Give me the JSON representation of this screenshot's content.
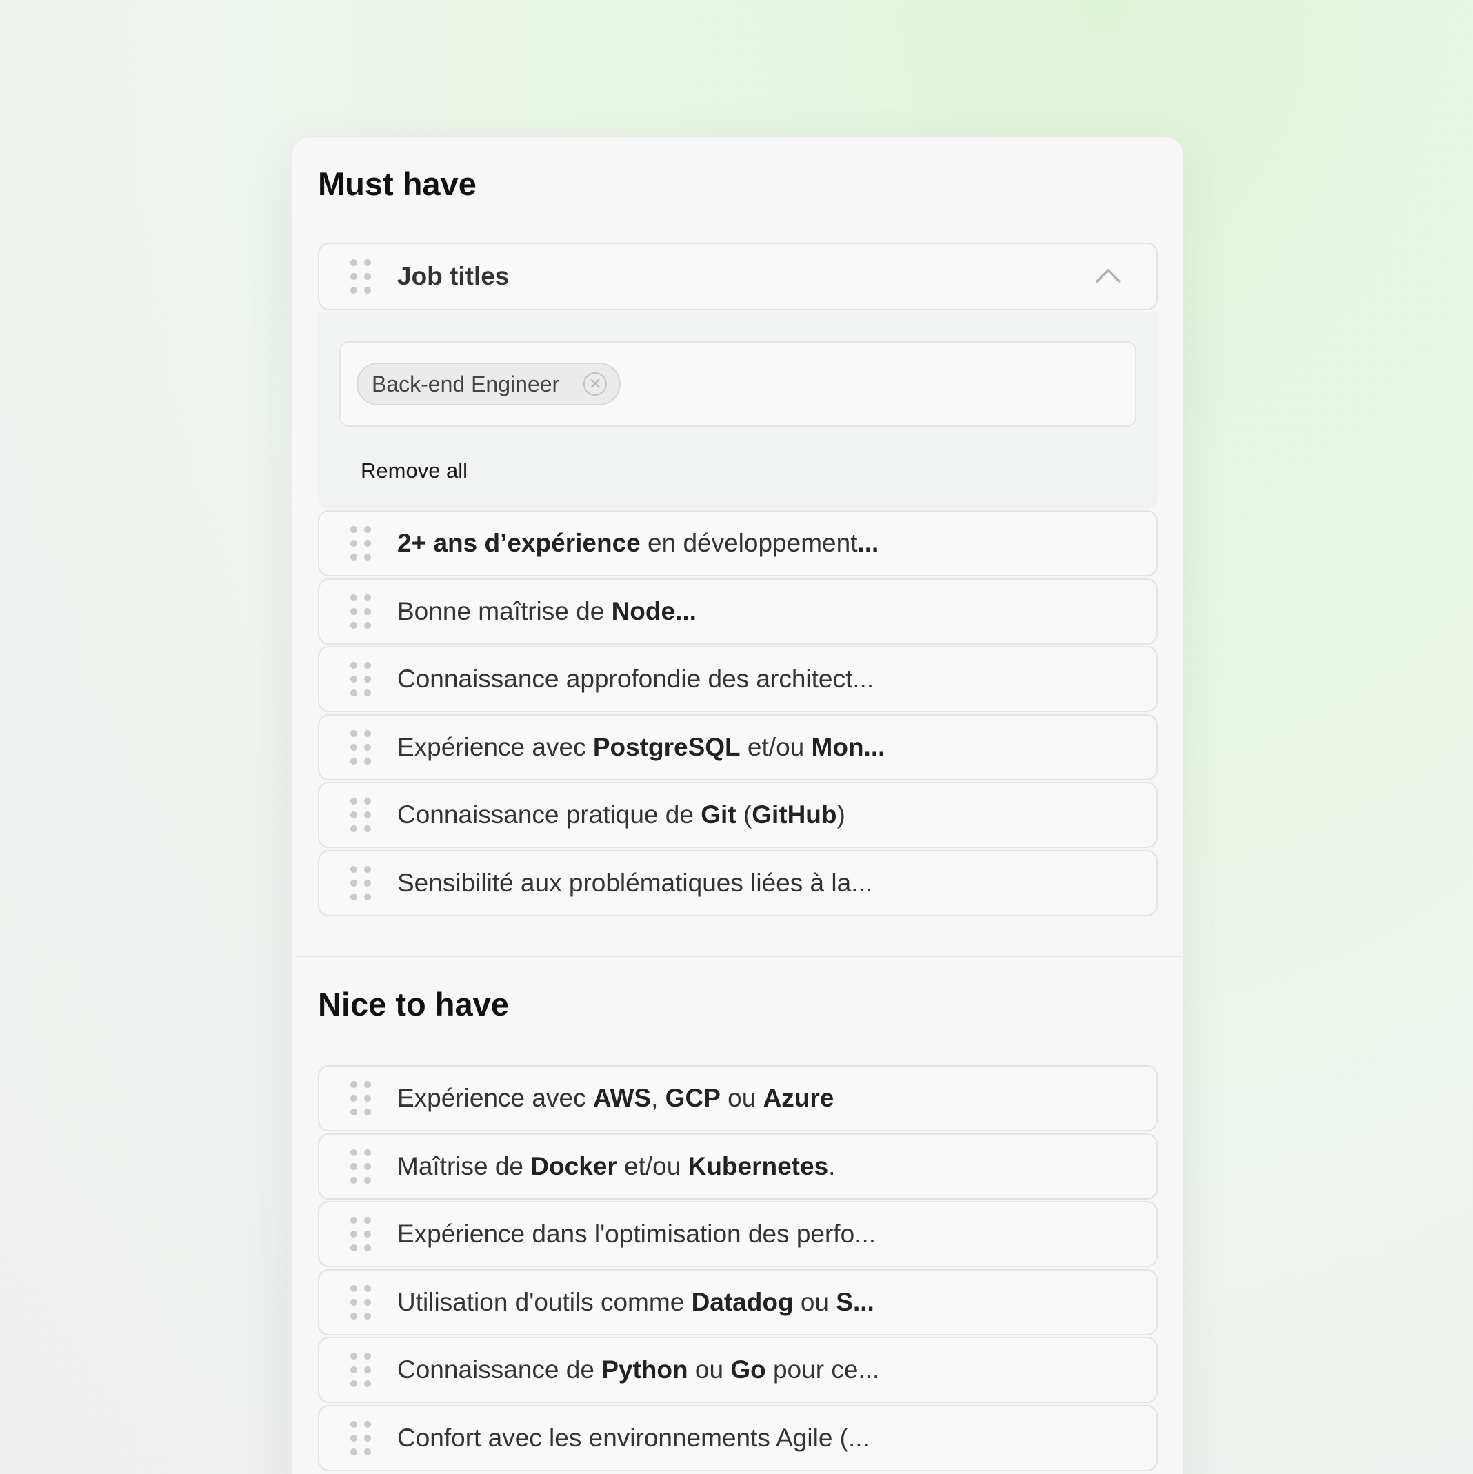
{
  "must_have": {
    "title": "Must have",
    "job_titles": {
      "label": "Job titles",
      "tags": [
        "Back-end Engineer"
      ],
      "remove_all": "Remove all"
    },
    "items": [
      [
        {
          "t": "2+ ans d’expérience",
          "b": true
        },
        {
          "t": " en développement"
        },
        {
          "t": "...",
          "b": true
        }
      ],
      [
        {
          "t": "Bonne maîtrise de "
        },
        {
          "t": "Node...",
          "b": true
        }
      ],
      [
        {
          "t": "Connaissance approfondie des architect..."
        }
      ],
      [
        {
          "t": "Expérience avec "
        },
        {
          "t": "PostgreSQL",
          "b": true
        },
        {
          "t": " et/ou "
        },
        {
          "t": "Mon...",
          "b": true
        }
      ],
      [
        {
          "t": "Connaissance pratique de "
        },
        {
          "t": "Git",
          "b": true
        },
        {
          "t": " ("
        },
        {
          "t": "GitHub",
          "b": true
        },
        {
          "t": ")"
        }
      ],
      [
        {
          "t": "Sensibilité aux problématiques liées à la..."
        }
      ]
    ]
  },
  "nice_to_have": {
    "title": "Nice to have",
    "items": [
      [
        {
          "t": "Expérience avec "
        },
        {
          "t": "AWS",
          "b": true
        },
        {
          "t": ", "
        },
        {
          "t": "GCP",
          "b": true
        },
        {
          "t": " ou "
        },
        {
          "t": "Azure",
          "b": true
        }
      ],
      [
        {
          "t": "Maîtrise de "
        },
        {
          "t": "Docker",
          "b": true
        },
        {
          "t": " et/ou "
        },
        {
          "t": "Kubernetes",
          "b": true
        },
        {
          "t": "."
        }
      ],
      [
        {
          "t": "Expérience dans l'optimisation des perfo..."
        }
      ],
      [
        {
          "t": "Utilisation d'outils comme "
        },
        {
          "t": "Datadog",
          "b": true
        },
        {
          "t": " ou "
        },
        {
          "t": "S...",
          "b": true
        }
      ],
      [
        {
          "t": "Connaissance de "
        },
        {
          "t": "Python",
          "b": true
        },
        {
          "t": " ou "
        },
        {
          "t": "Go",
          "b": true
        },
        {
          "t": " pour ce..."
        }
      ],
      [
        {
          "t": "Confort avec les environnements Agile (..."
        }
      ]
    ]
  },
  "icons": {
    "drag_handle": "drag-handle-icon",
    "collapse": "chevron-up-icon",
    "tag_remove": "close-circle-icon"
  }
}
